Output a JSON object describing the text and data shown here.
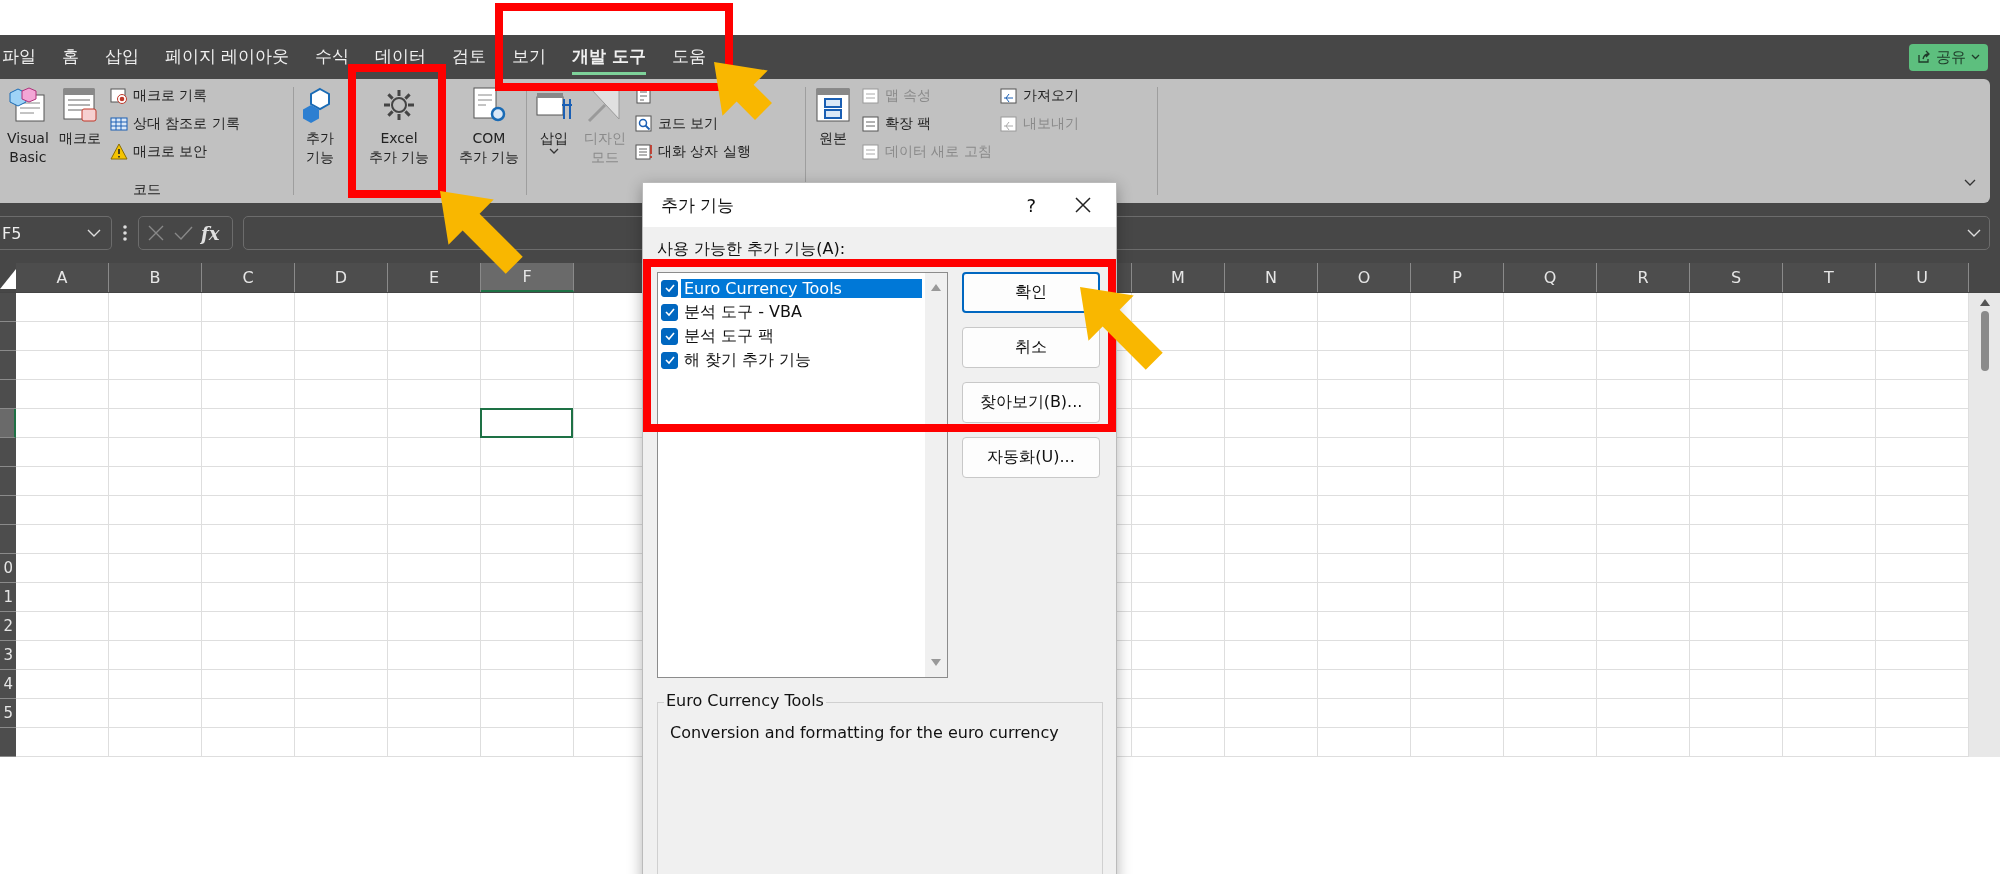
{
  "menu_tabs": [
    {
      "label": "파일",
      "selected": false
    },
    {
      "label": "홈",
      "selected": false
    },
    {
      "label": "삽입",
      "selected": false
    },
    {
      "label": "페이지 레이아웃",
      "selected": false
    },
    {
      "label": "수식",
      "selected": false
    },
    {
      "label": "데이터",
      "selected": false
    },
    {
      "label": "검토",
      "selected": false
    },
    {
      "label": "보기",
      "selected": false
    },
    {
      "label": "개발 도구",
      "selected": true
    },
    {
      "label": "도움",
      "selected": false
    }
  ],
  "share_button": {
    "label": "공유"
  },
  "ribbon": {
    "code_group": {
      "label": "코드",
      "visual_basic": [
        "Visual",
        "Basic"
      ],
      "macros": [
        "매크로"
      ],
      "commands": [
        "매크로 기록",
        "상대 참조로 기록",
        "매크로 보안"
      ]
    },
    "addins_group": {
      "buttons": [
        [
          "추가",
          "기능"
        ],
        [
          "Excel",
          "추가 기능"
        ],
        [
          "COM",
          "추가 기능"
        ]
      ]
    },
    "controls_group": {
      "insert": "삽입",
      "design_mode": {
        "lines": [
          "디자인",
          "모드"
        ],
        "disabled": true
      },
      "commands": [
        "코드 보기",
        "대화 상자 실행"
      ]
    },
    "xml_group": {
      "source": "원본",
      "commands": [
        {
          "label": "맵 속성",
          "disabled": true
        },
        {
          "label": "확장 팩",
          "disabled": false
        },
        {
          "label": "데이터 새로 고침",
          "disabled": true
        }
      ],
      "commands_2": [
        {
          "label": "가져오기",
          "disabled": false
        },
        {
          "label": "내보내기",
          "disabled": true
        }
      ]
    }
  },
  "formula_bar": {
    "name_box": "F5",
    "function_label": "fx"
  },
  "sheet": {
    "columns": [
      {
        "label": "A",
        "selected": false
      },
      {
        "label": "B",
        "selected": false
      },
      {
        "label": "C",
        "selected": false
      },
      {
        "label": "D",
        "selected": false
      },
      {
        "label": "E",
        "selected": false
      },
      {
        "label": "F",
        "selected": true
      },
      {
        "label": "M",
        "selected": false
      },
      {
        "label": "N",
        "selected": false
      },
      {
        "label": "O",
        "selected": false
      },
      {
        "label": "P",
        "selected": false
      },
      {
        "label": "Q",
        "selected": false
      },
      {
        "label": "R",
        "selected": false
      },
      {
        "label": "S",
        "selected": false
      },
      {
        "label": "T",
        "selected": false
      },
      {
        "label": "U",
        "selected": false
      }
    ],
    "rows": [
      {
        "selected": false
      },
      {
        "selected": false
      },
      {
        "selected": false
      },
      {
        "selected": false
      },
      {
        "selected": true
      },
      {
        "selected": false
      },
      {
        "selected": false
      },
      {
        "selected": false
      },
      {
        "selected": false
      },
      {
        "label": "0",
        "selected": false
      },
      {
        "label": "1",
        "selected": false
      },
      {
        "label": "2",
        "selected": false
      },
      {
        "label": "3",
        "selected": false
      },
      {
        "label": "4",
        "selected": false
      },
      {
        "label": "5",
        "selected": false
      },
      {
        "selected": false
      }
    ]
  },
  "dialog": {
    "title": "추가 기능",
    "help": "?",
    "list_label": "사용 가능한 추가 기능(A):",
    "addins": [
      {
        "label": "Euro Currency Tools",
        "checked": true,
        "selected": true
      },
      {
        "label": "분석 도구 - VBA",
        "checked": true,
        "selected": false
      },
      {
        "label": "분석 도구 팩",
        "checked": true,
        "selected": false
      },
      {
        "label": "해 찾기 추가 기능",
        "checked": true,
        "selected": false
      }
    ],
    "buttons": [
      {
        "label": "확인",
        "default": true
      },
      {
        "label": "취소",
        "default": false
      },
      {
        "label": "찾아보기(B)...",
        "default": false
      },
      {
        "label": "자동화(U)...",
        "default": false
      }
    ],
    "details": {
      "title": "Euro Currency Tools",
      "description": "Conversion and formatting for the euro currency"
    }
  }
}
